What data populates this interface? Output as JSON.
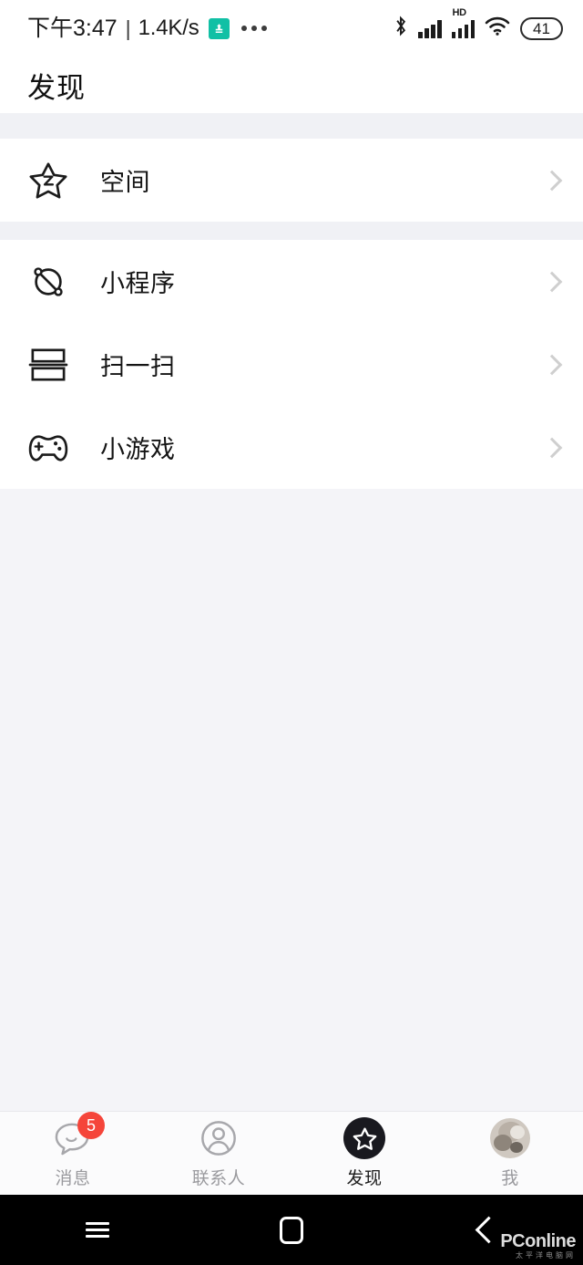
{
  "status_bar": {
    "time": "下午3:47",
    "separator": "|",
    "network_speed": "1.4K/s",
    "app_badge_icon": "green-app-badge-icon",
    "overflow_icon": "more-dots-icon",
    "bluetooth_icon": "bluetooth-icon",
    "signal_icon": "signal-bars-icon",
    "hd_label": "HD",
    "hd_signal_icon": "hd-signal-bars-icon",
    "wifi_icon": "wifi-icon",
    "battery_level": "41"
  },
  "header": {
    "title": "发现"
  },
  "sections": [
    {
      "items": [
        {
          "label": "空间",
          "icon": "qzone-star-icon",
          "chevron": "chevron-right-icon"
        }
      ]
    },
    {
      "items": [
        {
          "label": "小程序",
          "icon": "mini-program-orbit-icon",
          "chevron": "chevron-right-icon"
        },
        {
          "label": "扫一扫",
          "icon": "scan-icon",
          "chevron": "chevron-right-icon"
        },
        {
          "label": "小游戏",
          "icon": "gamepad-icon",
          "chevron": "chevron-right-icon"
        }
      ]
    }
  ],
  "tab_bar": {
    "tabs": [
      {
        "label": "消息",
        "icon": "chat-bubble-icon",
        "badge": "5",
        "active": false
      },
      {
        "label": "联系人",
        "icon": "contacts-person-icon",
        "badge": "",
        "active": false
      },
      {
        "label": "发现",
        "icon": "discover-star-icon",
        "badge": "",
        "active": true
      },
      {
        "label": "我",
        "icon": "profile-avatar-icon",
        "badge": "",
        "active": false
      }
    ]
  },
  "android_nav": {
    "menu_icon": "menu-icon",
    "home_icon": "home-square-icon",
    "back_icon": "back-chevron-icon"
  },
  "watermark": {
    "main": "PConline",
    "sub": "太平洋电脑网"
  },
  "colors": {
    "badge_red": "#f5453a",
    "app_badge_green": "#11c0a5",
    "page_bg": "#f4f4f8",
    "card_bg": "#ffffff",
    "active_tab": "#19191f"
  }
}
